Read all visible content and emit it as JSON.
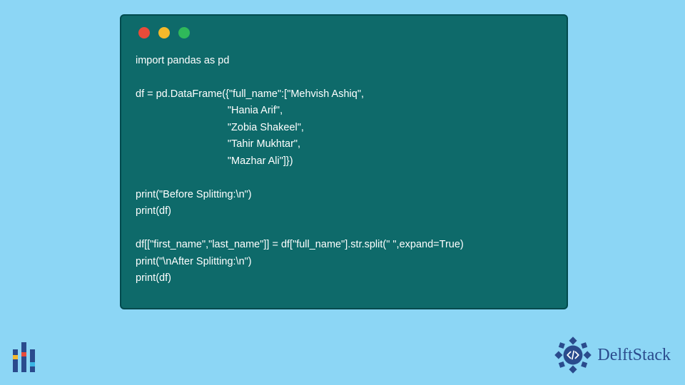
{
  "window": {
    "dots": [
      "red",
      "yellow",
      "green"
    ]
  },
  "code": {
    "lines": [
      "import pandas as pd",
      "",
      "df = pd.DataFrame({\"full_name\":[\"Mehvish Ashiq\",",
      "                                \"Hania Arif\",",
      "                                \"Zobia Shakeel\",",
      "                                \"Tahir Mukhtar\",",
      "                                \"Mazhar Ali\"]})",
      "",
      "print(\"Before Splitting:\\n\")",
      "print(df)",
      "",
      "df[[\"first_name\",\"last_name\"]] = df[\"full_name\"].str.split(\" \",expand=True)",
      "print(\"\\nAfter Splitting:\\n\")",
      "print(df)"
    ]
  },
  "brand": {
    "name": "DelftStack",
    "logo_color": "#2a4b8d"
  },
  "left_logo": {
    "bars": [
      {
        "segments": [
          {
            "h": 8,
            "c": "#2a4b8d"
          },
          {
            "h": 6,
            "c": "#f5b92b"
          },
          {
            "h": 18,
            "c": "#2a4b8d"
          }
        ]
      },
      {
        "segments": [
          {
            "h": 14,
            "c": "#2a4b8d"
          },
          {
            "h": 6,
            "c": "#e94b3a"
          },
          {
            "h": 22,
            "c": "#2a4b8d"
          }
        ]
      },
      {
        "segments": [
          {
            "h": 18,
            "c": "#2a4b8d"
          },
          {
            "h": 6,
            "c": "#3ab6e5"
          },
          {
            "h": 8,
            "c": "#2a4b8d"
          }
        ]
      }
    ]
  }
}
